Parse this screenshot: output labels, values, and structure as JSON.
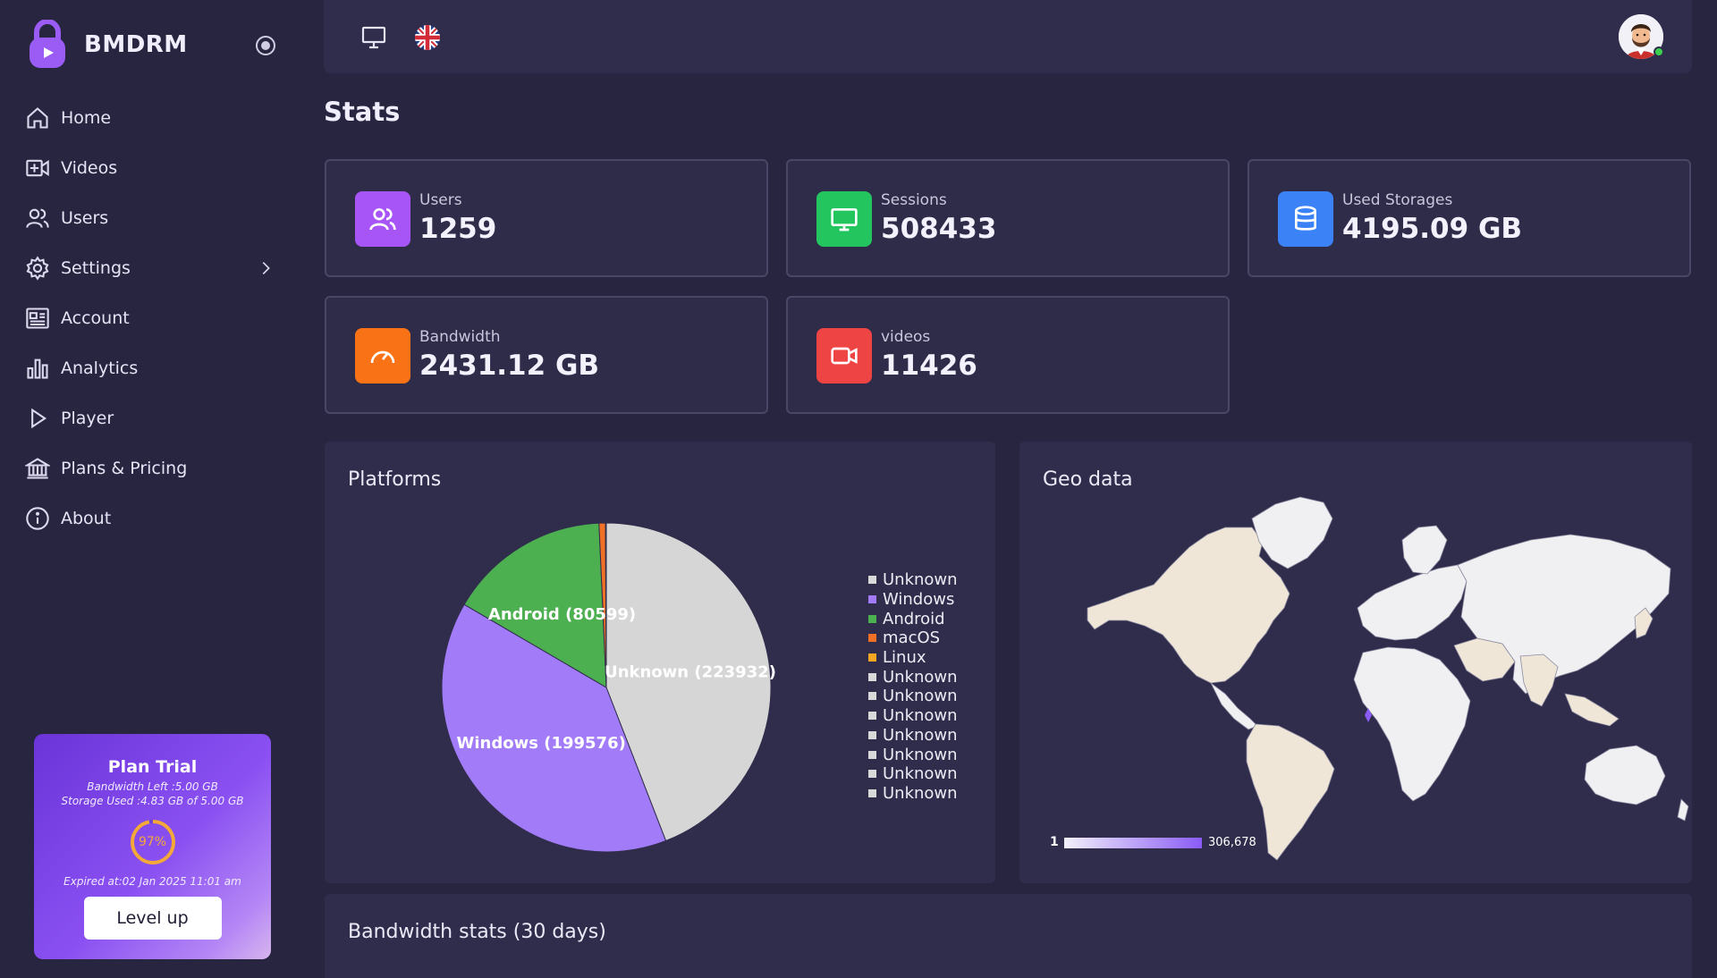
{
  "brand": {
    "name": "BMDRM"
  },
  "nav": [
    {
      "label": "Home",
      "icon": "home-icon"
    },
    {
      "label": "Videos",
      "icon": "video-add-icon"
    },
    {
      "label": "Users",
      "icon": "users-icon"
    },
    {
      "label": "Settings",
      "icon": "gear-icon"
    },
    {
      "label": "Account",
      "icon": "account-card-icon"
    },
    {
      "label": "Analytics",
      "icon": "bar-chart-icon"
    },
    {
      "label": "Player",
      "icon": "play-icon"
    },
    {
      "label": "Plans & Pricing",
      "icon": "bank-icon"
    },
    {
      "label": "About",
      "icon": "info-icon"
    }
  ],
  "plan": {
    "title": "Plan Trial",
    "bandwidth_left": "Bandwidth Left :5.00 GB",
    "storage_used": "Storage Used :4.83 GB of 5.00 GB",
    "usage_percent": "97%",
    "usage_value": 97,
    "expired": "Expired at:02 Jan 2025 11:01 am",
    "button": "Level up"
  },
  "page": {
    "title": "Stats"
  },
  "stats": [
    {
      "label": "Users",
      "value": "1259",
      "color": "#a855f7",
      "icon": "users-icon"
    },
    {
      "label": "Sessions",
      "value": "508433",
      "color": "#22c55e",
      "icon": "monitor-icon"
    },
    {
      "label": "Used Storages",
      "value": "4195.09 GB",
      "color": "#3b82f6",
      "icon": "database-icon"
    },
    {
      "label": "Bandwidth",
      "value": "2431.12 GB",
      "color": "#f97316",
      "icon": "speedometer-icon"
    },
    {
      "label": "videos",
      "value": "11426",
      "color": "#ef4444",
      "icon": "video-camera-icon"
    }
  ],
  "platforms": {
    "title": "Platforms",
    "legend": [
      {
        "label": "Unknown",
        "color": "#d9d9d9"
      },
      {
        "label": "Windows",
        "color": "#a27cf8"
      },
      {
        "label": "Android",
        "color": "#4caf50"
      },
      {
        "label": "macOS",
        "color": "#f07026"
      },
      {
        "label": "Linux",
        "color": "#f5a623"
      },
      {
        "label": "Unknown",
        "color": "#d9d9d9"
      },
      {
        "label": "Unknown",
        "color": "#d9d9d9"
      },
      {
        "label": "Unknown",
        "color": "#d9d9d9"
      },
      {
        "label": "Unknown",
        "color": "#d9d9d9"
      },
      {
        "label": "Unknown",
        "color": "#d9d9d9"
      },
      {
        "label": "Unknown",
        "color": "#d9d9d9"
      },
      {
        "label": "Unknown",
        "color": "#d9d9d9"
      }
    ]
  },
  "chart_data": {
    "type": "pie",
    "title": "Platforms",
    "slices": [
      {
        "name": "Unknown",
        "value": 223932,
        "color": "#d6d6d6",
        "label": "Unknown (223932)"
      },
      {
        "name": "Windows",
        "value": 199576,
        "color": "#a27cf8",
        "label": "Windows (199576)"
      },
      {
        "name": "Android",
        "value": 80599,
        "color": "#4caf50",
        "label": "Android (80599)"
      },
      {
        "name": "macOS",
        "value": 3200,
        "color": "#f07026",
        "label": ""
      },
      {
        "name": "Linux",
        "value": 400,
        "color": "#f5a623",
        "label": ""
      }
    ],
    "legend_position": "right"
  },
  "geo": {
    "title": "Geo data",
    "scale_min": "1",
    "scale_max": "306,678"
  },
  "bandwidth": {
    "title": "Bandwidth stats (30 days)"
  },
  "colors": {
    "bg": "#272540",
    "panel": "#302d4c",
    "accent": "#8a5cf6"
  }
}
